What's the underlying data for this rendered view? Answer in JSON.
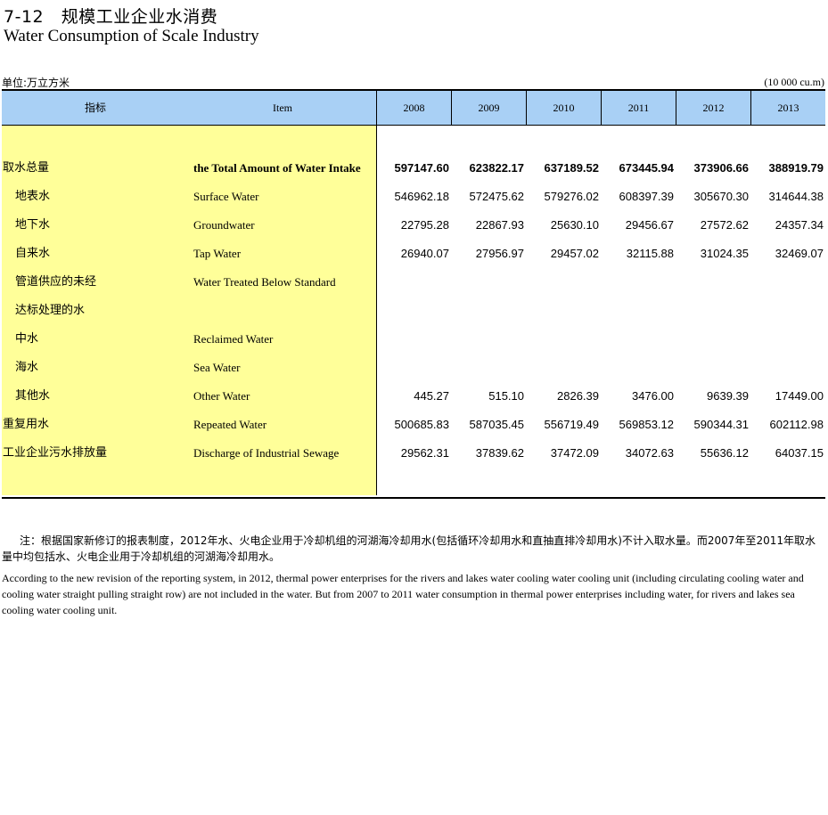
{
  "title": {
    "number": "7-12",
    "cn": "规模工业企业水消费",
    "en": "Water Consumption of Scale Industry"
  },
  "unit": {
    "cn": "单位:万立方米",
    "en": "(10 000 cu.m)"
  },
  "header": {
    "indicator_cn": "指标",
    "item_en": "Item",
    "years": [
      "2008",
      "2009",
      "2010",
      "2011",
      "2012",
      "2013"
    ]
  },
  "rows": [
    {
      "cn": "取水总量",
      "en": "the Total Amount of Water Intake",
      "values": [
        "597147.60",
        "623822.17",
        "637189.52",
        "673445.94",
        "373906.66",
        "388919.79"
      ]
    },
    {
      "cn": "地表水",
      "en": "Surface Water",
      "values": [
        "546962.18",
        "572475.62",
        "579276.02",
        "608397.39",
        "305670.30",
        "314644.38"
      ]
    },
    {
      "cn": "地下水",
      "en": "Groundwater",
      "values": [
        "22795.28",
        "22867.93",
        "25630.10",
        "29456.67",
        "27572.62",
        "24357.34"
      ]
    },
    {
      "cn": "自来水",
      "en": "Tap Water",
      "values": [
        "26940.07",
        "27956.97",
        "29457.02",
        "32115.88",
        "31024.35",
        "32469.07"
      ]
    },
    {
      "cn": "管道供应的未经",
      "en": "Water Treated Below Standard",
      "values": [
        "",
        "",
        "",
        "",
        "",
        ""
      ]
    },
    {
      "cn": "达标处理的水",
      "en": "",
      "values": [
        "",
        "",
        "",
        "",
        "",
        ""
      ]
    },
    {
      "cn": "中水",
      "en": "Reclaimed Water",
      "values": [
        "",
        "",
        "",
        "",
        "",
        ""
      ]
    },
    {
      "cn": "海水",
      "en": "Sea Water",
      "values": [
        "",
        "",
        "",
        "",
        "",
        ""
      ]
    },
    {
      "cn": "其他水",
      "en": "Other Water",
      "values": [
        "445.27",
        "515.10",
        "2826.39",
        "3476.00",
        "9639.39",
        "17449.00"
      ]
    },
    {
      "cn": "重复用水",
      "en": "Repeated Water",
      "values": [
        "500685.83",
        "587035.45",
        "556719.49",
        "569853.12",
        "590344.31",
        "602112.98"
      ]
    },
    {
      "cn": "工业企业污水排放量",
      "en": "Discharge of Industrial Sewage",
      "values": [
        "29562.31",
        "37839.62",
        "37472.09",
        "34072.63",
        "55636.12",
        "64037.15"
      ]
    }
  ],
  "note": {
    "cn": "注：根据国家新修订的报表制度，2012年水、火电企业用于冷却机组的河湖海冷却用水(包括循环冷却用水和直抽直排冷却用水)不计入取水量。而2007年至2011年取水量中均包括水、火电企业用于冷却机组的河湖海冷却用水。",
    "en": "According to the new revision of the reporting system, in 2012, thermal power enterprises for the rivers and lakes water cooling water cooling unit (including circulating cooling water and cooling water straight pulling straight row) are not included in the water. But from 2007 to 2011 water consumption in thermal power enterprises including water, for rivers and lakes sea cooling water cooling unit."
  }
}
